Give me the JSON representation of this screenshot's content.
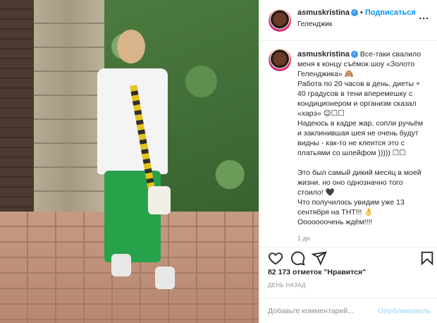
{
  "post": {
    "username": "asmuskristina",
    "follow_label": "Подписаться",
    "location": "Геленджик",
    "more_label": "...",
    "verified_glyph": "✓",
    "caption": "Все-таки свалило меня к концу съёмок шоу «Золото Геленджика» 🙈\nРабота по 20 часов в день, диеты + 40 градусов в тени вперемешку с кондиционером и организм сказал «харэ» 😉☐☐\nНадеюсь в кадре жар, сопли ручьём и заклинившая шея не очень будут видны - как-то не клеится это с платьями со шлейфом ))))) ☐☐\n\nЭто был самый дикий месяц в моей жизни. но оно однозначно того стоило! 🖤\nЧто получилось увидим уже 13 сентября на ТНТ!!! 👌\nОоооооочень ждём!!!!",
    "time_ago": "1 дн.",
    "likes": "82 173 отметок \"Нравится\"",
    "date": "ДЕНЬ НАЗАД",
    "comment_placeholder": "Добавьте комментарий...",
    "publish_label": "Опубликовать"
  },
  "icons": {
    "like": "heart-icon",
    "comment": "comment-icon",
    "share": "paper-plane-icon",
    "save": "bookmark-icon",
    "verified": "verified-badge-icon",
    "more": "ellipsis-icon"
  },
  "colors": {
    "accent": "#0095f6",
    "verified": "#3897f0",
    "muted": "#8e8e8e",
    "publish_disabled": "#b2dffc"
  }
}
